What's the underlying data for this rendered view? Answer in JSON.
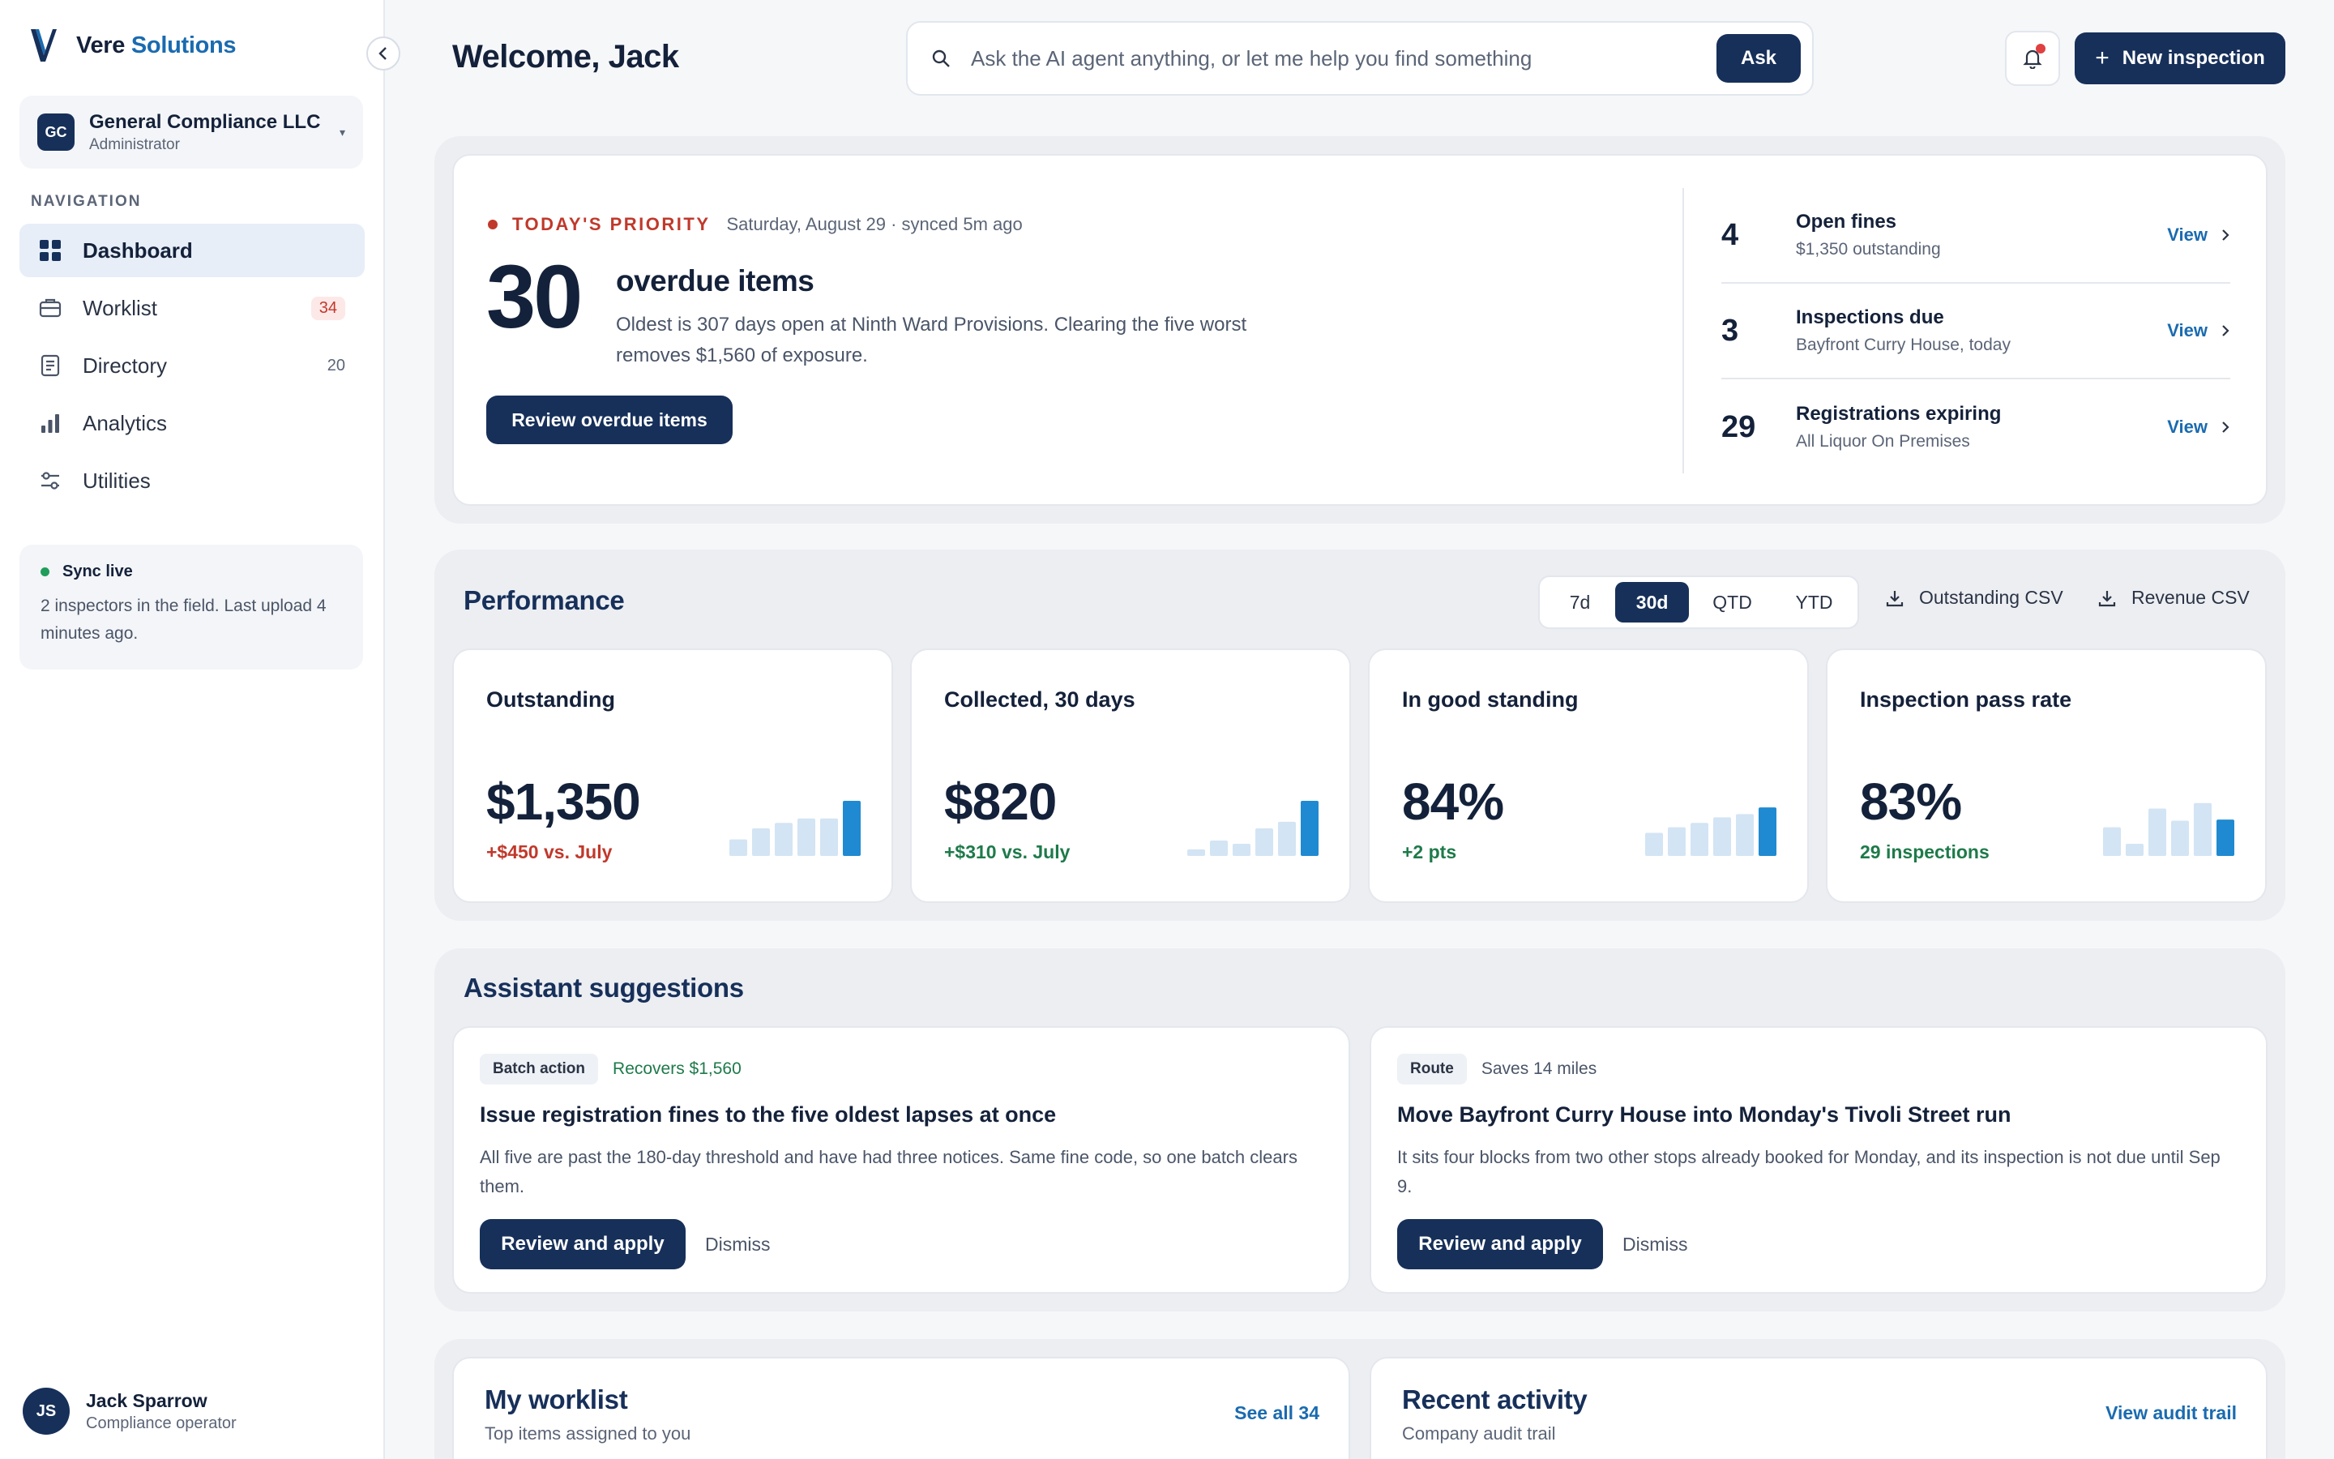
{
  "app": {
    "brand_primary": "Vere",
    "brand_accent": "Solutions",
    "colors": {
      "navy": "#17305a",
      "accent": "#1a6bb0",
      "alert": "#c0392b",
      "success": "#1e7a4a"
    }
  },
  "org": {
    "initials": "GC",
    "name": "General Compliance LLC",
    "role": "Administrator",
    "caret": "▾"
  },
  "nav": {
    "heading": "NAVIGATION",
    "items": [
      {
        "label": "Dashboard",
        "icon": "grid-icon",
        "count": ""
      },
      {
        "label": "Worklist",
        "icon": "briefcase-icon",
        "count": "34"
      },
      {
        "label": "Directory",
        "icon": "book-icon",
        "count": "20"
      },
      {
        "label": "Analytics",
        "icon": "bar-chart-icon",
        "count": ""
      },
      {
        "label": "Utilities",
        "icon": "sliders-icon",
        "count": ""
      }
    ]
  },
  "sync": {
    "title": "Sync live",
    "body": "2 inspectors in the field. Last upload 4 minutes ago."
  },
  "user": {
    "initials": "JS",
    "name": "Jack Sparrow",
    "role": "Compliance operator"
  },
  "header": {
    "welcome": "Welcome, Jack",
    "search_placeholder": "Ask the AI agent anything, or let me help you find something",
    "ask_label": "Ask",
    "new_label": "New inspection",
    "new_plus": "+"
  },
  "priority": {
    "label": "TODAY'S PRIORITY",
    "date": "Saturday, August 29 · synced 5m ago",
    "count": "30",
    "heading": "overdue items",
    "description": "Oldest is 307 days open at Ninth Ward Provisions. Clearing the five worst removes $1,560 of exposure.",
    "cta": "Review overdue items",
    "quick": [
      {
        "num": "4",
        "title": "Open fines",
        "sub": "$1,350 outstanding",
        "view": "View"
      },
      {
        "num": "3",
        "title": "Inspections due",
        "sub": "Bayfront Curry House, today",
        "view": "View"
      },
      {
        "num": "29",
        "title": "Registrations expiring",
        "sub": "All Liquor On Premises",
        "view": "View"
      }
    ]
  },
  "performance": {
    "title": "Performance",
    "ranges": [
      "7d",
      "30d",
      "QTD",
      "YTD"
    ],
    "active_range": "30d",
    "csv_outstanding": "Outstanding CSV",
    "csv_revenue": "Revenue CSV",
    "kpis": [
      {
        "label": "Outstanding",
        "value": "$1,350",
        "delta": "+$450 vs. July",
        "tone": "neg",
        "bars": [
          0.3,
          0.5,
          0.6,
          0.68,
          0.68,
          1.0
        ]
      },
      {
        "label": "Collected, 30 days",
        "value": "$820",
        "delta": "+$310 vs. July",
        "tone": "pos",
        "bars": [
          0.12,
          0.28,
          0.22,
          0.5,
          0.62,
          1.0
        ]
      },
      {
        "label": "In good standing",
        "value": "84%",
        "delta": "+2 pts",
        "tone": "pos",
        "bars": [
          0.42,
          0.52,
          0.6,
          0.7,
          0.76,
          0.88
        ]
      },
      {
        "label": "Inspection pass rate",
        "value": "83%",
        "delta": "29 inspections",
        "tone": "pos",
        "bars": [
          0.52,
          0.22,
          0.86,
          0.64,
          0.96,
          0.66
        ]
      }
    ]
  },
  "assistant": {
    "title": "Assistant suggestions",
    "suggestions": [
      {
        "tag": "Batch action",
        "meta": "Recovers $1,560",
        "meta_tone": "green",
        "heading": "Issue registration fines to the five oldest lapses at once",
        "body": "All five are past the 180-day threshold and have had three notices. Same fine code, so one batch clears them.",
        "apply": "Review and apply",
        "dismiss": "Dismiss"
      },
      {
        "tag": "Route",
        "meta": "Saves 14 miles",
        "meta_tone": "gray",
        "heading": "Move Bayfront Curry House into Monday's Tivoli Street run",
        "body": "It sits four blocks from two other stops already booked for Monday, and its inspection is not due until Sep 9.",
        "apply": "Review and apply",
        "dismiss": "Dismiss"
      }
    ]
  },
  "worklist": {
    "title": "My worklist",
    "sub": "Top items assigned to you",
    "link": "See all 34"
  },
  "activity": {
    "title": "Recent activity",
    "sub": "Company audit trail",
    "link": "View audit trail"
  }
}
